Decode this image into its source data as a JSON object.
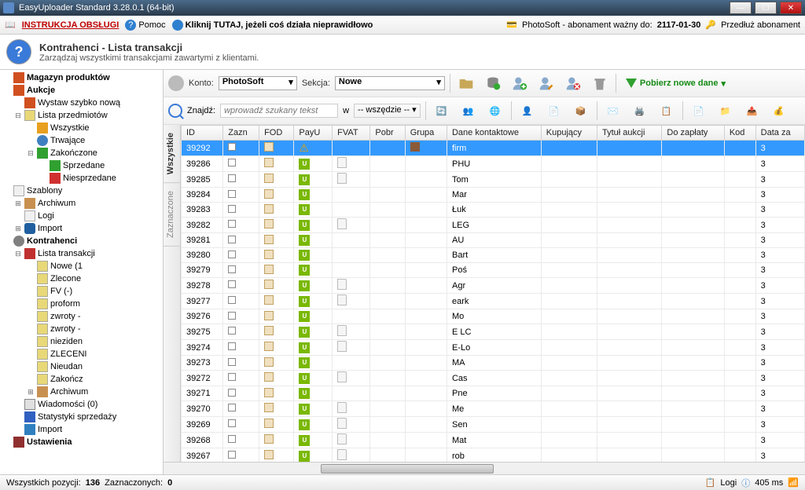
{
  "window": {
    "title": "EasyUploader Standard 3.28.0.1 (64-bit)"
  },
  "menubar": {
    "manual": "INSTRUKCJA OBSŁUGI",
    "help": "Pomoc",
    "click_here": "Kliknij TUTAJ, jeżeli coś działa nieprawidłowo",
    "sub_label": "PhotoSoft - abonament ważny do:",
    "sub_date": "2117-01-30",
    "extend": "Przedłuż abonament"
  },
  "header": {
    "title": "Kontrahenci - Lista transakcji",
    "subtitle": "Zarządzaj wszystkimi transakcjami zawartymi z klientami."
  },
  "sidebar": [
    {
      "label": "Magazyn produktów",
      "icon": "ic-hammer",
      "depth": 0,
      "bold": true,
      "exp": ""
    },
    {
      "label": "Aukcje",
      "icon": "ic-hammer",
      "depth": 0,
      "bold": true,
      "exp": ""
    },
    {
      "label": "Wystaw szybko nową",
      "icon": "ic-hammer",
      "depth": 1,
      "exp": ""
    },
    {
      "label": "Lista przedmiotów",
      "icon": "ic-folder",
      "depth": 1,
      "exp": "⊟"
    },
    {
      "label": "Wszystkie",
      "icon": "ic-star",
      "depth": 2,
      "exp": ""
    },
    {
      "label": "Trwające",
      "icon": "ic-clock",
      "depth": 2,
      "exp": ""
    },
    {
      "label": "Zakończone",
      "icon": "ic-check",
      "depth": 2,
      "exp": "⊟"
    },
    {
      "label": "Sprzedane",
      "icon": "ic-dollar",
      "depth": 3,
      "exp": ""
    },
    {
      "label": "Niesprzedane",
      "icon": "ic-dollar-r",
      "depth": 3,
      "exp": ""
    },
    {
      "label": "Szablony",
      "icon": "ic-page",
      "depth": 0,
      "exp": ""
    },
    {
      "label": "Archiwum",
      "icon": "ic-arch",
      "depth": 1,
      "exp": "⊞"
    },
    {
      "label": "Logi",
      "icon": "ic-page",
      "depth": 1,
      "exp": ""
    },
    {
      "label": "Import",
      "icon": "ic-db",
      "depth": 1,
      "exp": "⊞"
    },
    {
      "label": "Kontrahenci",
      "icon": "ic-people",
      "depth": 0,
      "bold": true,
      "exp": ""
    },
    {
      "label": "Lista transakcji",
      "icon": "ic-trans",
      "depth": 1,
      "exp": "⊟"
    },
    {
      "label": "Nowe (1",
      "icon": "ic-folder",
      "depth": 2,
      "exp": ""
    },
    {
      "label": "Zlecone",
      "icon": "ic-folder",
      "depth": 2,
      "exp": ""
    },
    {
      "label": "FV (-)",
      "icon": "ic-folder",
      "depth": 2,
      "exp": ""
    },
    {
      "label": "proform",
      "icon": "ic-folder",
      "depth": 2,
      "exp": ""
    },
    {
      "label": "zwroty -",
      "icon": "ic-folder",
      "depth": 2,
      "exp": ""
    },
    {
      "label": "zwroty -",
      "icon": "ic-folder",
      "depth": 2,
      "exp": ""
    },
    {
      "label": "nieziden",
      "icon": "ic-folder",
      "depth": 2,
      "exp": ""
    },
    {
      "label": "ZLECENI",
      "icon": "ic-folder",
      "depth": 2,
      "exp": ""
    },
    {
      "label": "Nieudan",
      "icon": "ic-folder",
      "depth": 2,
      "exp": ""
    },
    {
      "label": "Zakończ",
      "icon": "ic-folder",
      "depth": 2,
      "exp": ""
    },
    {
      "label": "Archiwum",
      "icon": "ic-arch",
      "depth": 2,
      "exp": "⊞"
    },
    {
      "label": "Wiadomości (0)",
      "icon": "ic-mail",
      "depth": 1,
      "exp": ""
    },
    {
      "label": "Statystyki sprzedaży",
      "icon": "ic-chart",
      "depth": 1,
      "exp": ""
    },
    {
      "label": "Import",
      "icon": "ic-import",
      "depth": 1,
      "exp": ""
    },
    {
      "label": "Ustawienia",
      "icon": "ic-wrench",
      "depth": 0,
      "bold": true,
      "exp": ""
    }
  ],
  "toolbar": {
    "account_label": "Konto:",
    "account_value": "PhotoSoft",
    "section_label": "Sekcja:",
    "section_value": "Nowe",
    "fetch": "Pobierz nowe dane",
    "search_label": "Znajdź:",
    "search_placeholder": "wprowadź szukany tekst",
    "search_in_label": "w",
    "search_in_value": "-- wszędzie --"
  },
  "vtabs": {
    "all": "Wszystkie",
    "marked": "Zaznaczone"
  },
  "columns": [
    "ID",
    "Zazn",
    "FOD",
    "PayU",
    "FVAT",
    "Pobr",
    "Grupa",
    "Dane kontaktowe",
    "Kupujący",
    "Tytuł aukcji",
    "Do zapłaty",
    "Kod",
    "Data za"
  ],
  "rows": [
    {
      "id": "39292",
      "payu": "warn",
      "fvat": false,
      "grup": true,
      "dane": "firm",
      "right": "3",
      "sel": true
    },
    {
      "id": "39286",
      "payu": "u",
      "fvat": true,
      "dane": "PHU",
      "right": "3"
    },
    {
      "id": "39285",
      "payu": "u",
      "fvat": true,
      "dane": "Tom",
      "right": "3"
    },
    {
      "id": "39284",
      "payu": "u",
      "fvat": false,
      "dane": "Mar",
      "right": "3"
    },
    {
      "id": "39283",
      "payu": "u",
      "fvat": false,
      "dane": "Łuk",
      "right": "3"
    },
    {
      "id": "39282",
      "payu": "u",
      "fvat": true,
      "dane": "LEG",
      "right": "3"
    },
    {
      "id": "39281",
      "payu": "u",
      "fvat": false,
      "dane": "AU",
      "right": "3"
    },
    {
      "id": "39280",
      "payu": "u",
      "fvat": false,
      "dane": "Bart",
      "right": "3"
    },
    {
      "id": "39279",
      "payu": "u",
      "fvat": false,
      "dane": "Poś",
      "right": "3"
    },
    {
      "id": "39278",
      "payu": "u",
      "fvat": true,
      "dane": "Agr",
      "right": "3"
    },
    {
      "id": "39277",
      "payu": "u",
      "fvat": true,
      "dane": "eark",
      "right": "3"
    },
    {
      "id": "39276",
      "payu": "u",
      "fvat": false,
      "dane": "Mo",
      "right": "3"
    },
    {
      "id": "39275",
      "payu": "u",
      "fvat": true,
      "dane": "E LC",
      "right": "3"
    },
    {
      "id": "39274",
      "payu": "u",
      "fvat": true,
      "dane": "E-Lo",
      "right": "3"
    },
    {
      "id": "39273",
      "payu": "u",
      "fvat": false,
      "dane": "MA",
      "right": "3"
    },
    {
      "id": "39272",
      "payu": "u",
      "fvat": true,
      "dane": "Cas",
      "right": "3"
    },
    {
      "id": "39271",
      "payu": "u",
      "fvat": false,
      "dane": "Pne",
      "right": "3"
    },
    {
      "id": "39270",
      "payu": "u",
      "fvat": true,
      "dane": "Me",
      "right": "3"
    },
    {
      "id": "39269",
      "payu": "u",
      "fvat": true,
      "dane": "Sen",
      "right": "3"
    },
    {
      "id": "39268",
      "payu": "u",
      "fvat": true,
      "dane": "Mat",
      "right": "3"
    },
    {
      "id": "39267",
      "payu": "u",
      "fvat": true,
      "dane": "rob",
      "right": "3"
    }
  ],
  "status": {
    "total_label": "Wszystkich pozycji:",
    "total_value": "136",
    "marked_label": "Zaznaczonych:",
    "marked_value": "0",
    "logs": "Logi",
    "latency": "405 ms"
  }
}
